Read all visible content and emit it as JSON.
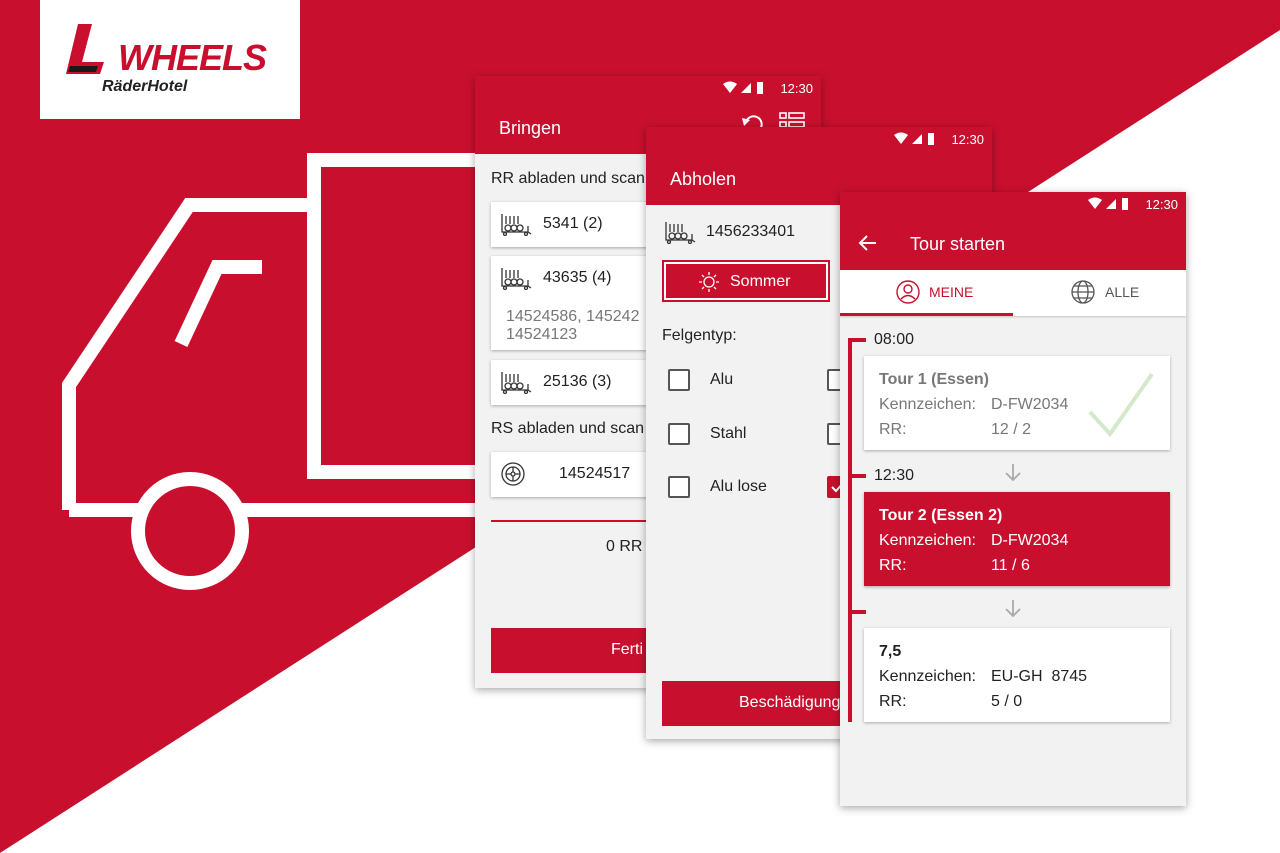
{
  "colors": {
    "brand": "#c8102e",
    "white": "#ffffff",
    "panel": "#f2f2f2"
  },
  "logo": {
    "wordmark": "WHEELS",
    "subline": "RäderHotel"
  },
  "status": {
    "time": "12:30"
  },
  "bringen": {
    "title": "Bringen",
    "rr_heading": "RR abladen und scan",
    "items": [
      {
        "label": "5341 (2)"
      },
      {
        "label": "43635 (4)",
        "detail_1": "14524586, 145242",
        "detail_2": "14524123"
      },
      {
        "label": "25136 (3)"
      }
    ],
    "rs_heading": "RS abladen und scan",
    "rs_item": "14524517",
    "summary": "0 RR -",
    "finish_label": "Ferti"
  },
  "abholen": {
    "title": "Abholen",
    "rack_number": "1456233401",
    "season_label": "Sommer",
    "rim_type_label": "Felgentyp:",
    "options": [
      "Alu",
      "Stahl",
      "Alu lose"
    ],
    "damage_label": "Beschädigung"
  },
  "tour": {
    "title": "Tour starten",
    "tab_mine": "MEINE",
    "tab_all": "ALLE",
    "times": [
      "08:00",
      "12:30"
    ],
    "plate_label": "Kennzeichen:",
    "rr_label": "RR:",
    "cards": [
      {
        "title": "Tour 1 (Essen)",
        "plate": "D-FW2034",
        "rr": "12 / 2",
        "state": "done"
      },
      {
        "title": "Tour 2 (Essen 2)",
        "plate": "D-FW2034",
        "rr": "11 / 6",
        "state": "active"
      },
      {
        "title": "7,5",
        "plate": "EU-GH  8745",
        "rr": "5 / 0",
        "state": "pending"
      }
    ]
  }
}
